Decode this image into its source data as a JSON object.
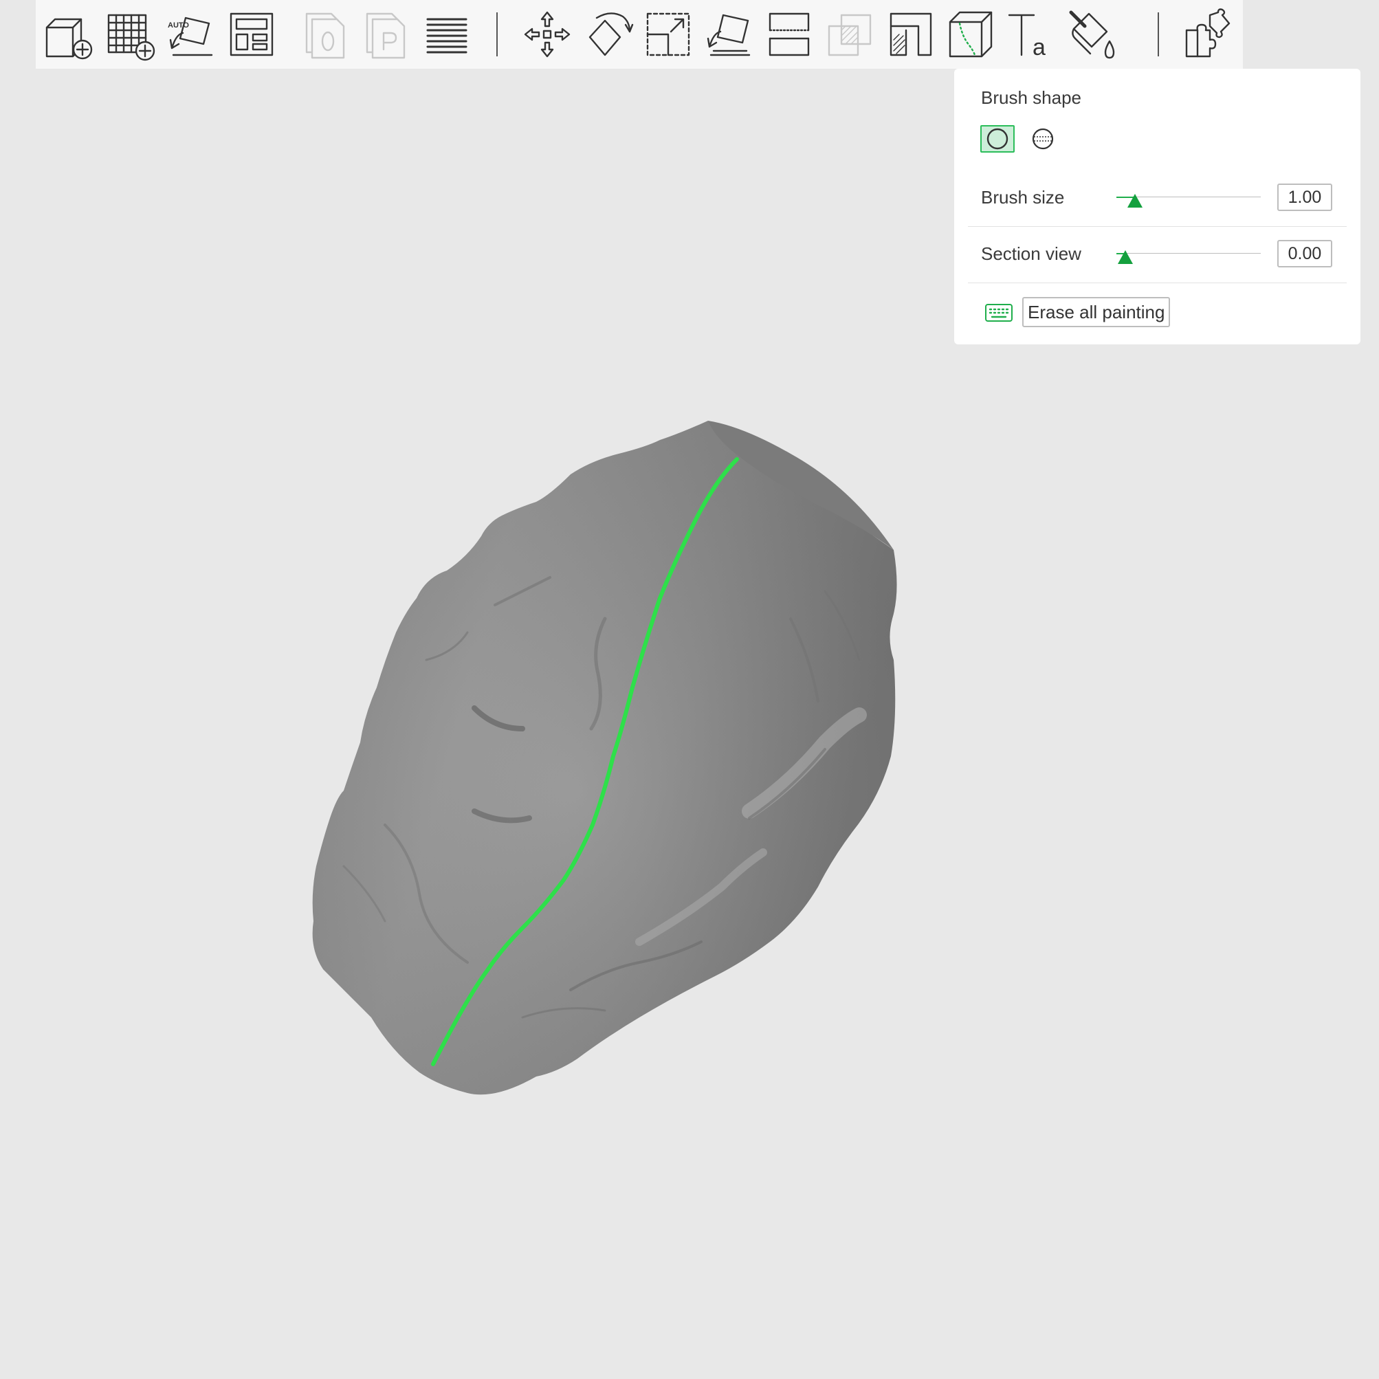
{
  "toolbar": {
    "items": [
      {
        "name": "add-object-button",
        "icon": "cube-plus-icon",
        "enabled": true
      },
      {
        "name": "add-plate-button",
        "icon": "grid-plus-icon",
        "enabled": true
      },
      {
        "name": "auto-orient-button",
        "icon": "auto-orient-icon",
        "enabled": true,
        "badge": "AUTO"
      },
      {
        "name": "arrange-button",
        "icon": "arrange-icon",
        "enabled": true
      },
      {
        "name": "copy-button",
        "icon": "copy-file-icon",
        "enabled": false
      },
      {
        "name": "paste-button",
        "icon": "paste-file-icon",
        "enabled": false
      },
      {
        "name": "layers-button",
        "icon": "layers-icon",
        "enabled": true
      },
      {
        "name": "move-button",
        "icon": "move-icon",
        "enabled": true
      },
      {
        "name": "rotate-button",
        "icon": "rotate-icon",
        "enabled": true
      },
      {
        "name": "scale-button",
        "icon": "scale-icon",
        "enabled": true
      },
      {
        "name": "lay-on-face-button",
        "icon": "lay-on-face-icon",
        "enabled": true
      },
      {
        "name": "cut-button",
        "icon": "cut-icon",
        "enabled": true
      },
      {
        "name": "boolean-button",
        "icon": "boolean-icon",
        "enabled": false
      },
      {
        "name": "support-painting-button",
        "icon": "support-paint-icon",
        "enabled": true
      },
      {
        "name": "seam-painting-button",
        "icon": "seam-paint-icon",
        "enabled": true,
        "active": true
      },
      {
        "name": "text-button",
        "icon": "text-icon",
        "enabled": true,
        "glyph": "Ta"
      },
      {
        "name": "color-painting-button",
        "icon": "paint-bucket-icon",
        "enabled": true
      },
      {
        "name": "assembly-button",
        "icon": "puzzle-icon",
        "enabled": true
      }
    ]
  },
  "paint_panel": {
    "brush_shape_label": "Brush shape",
    "brush_shapes": [
      {
        "name": "circle",
        "icon": "circle-brush-icon",
        "active": true
      },
      {
        "name": "sphere",
        "icon": "sphere-brush-icon",
        "active": false
      }
    ],
    "brush_size_label": "Brush size",
    "brush_size_value": "1.00",
    "brush_size_fraction": 0.13,
    "section_view_label": "Section view",
    "section_view_value": "0.00",
    "section_view_fraction": 0.06,
    "erase_button_label": "Erase all painting",
    "shortcut_icon": "keyboard-icon"
  },
  "viewport": {
    "model": "rock-sculpt-model",
    "seam_color": "#2ee04a",
    "model_color": "#8a8a8a",
    "background_color": "#e8e8e8"
  }
}
